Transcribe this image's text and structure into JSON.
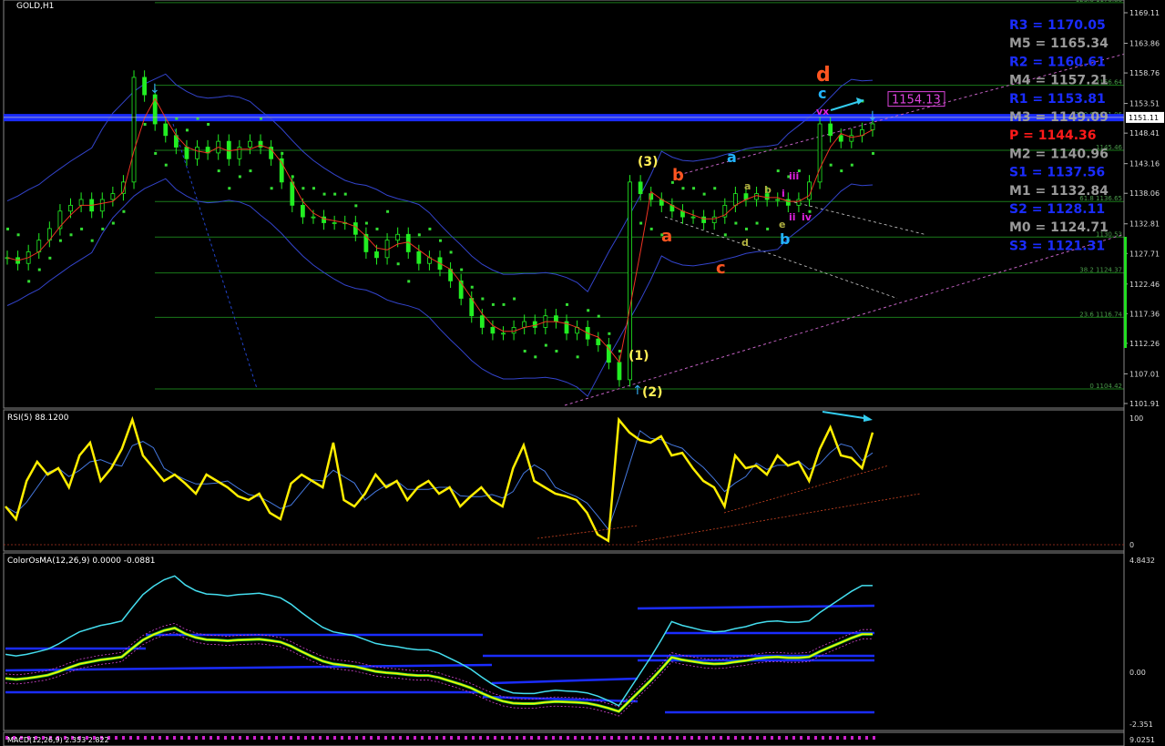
{
  "chart_data": {
    "type": "line",
    "title": "GOLD,H1",
    "price_axis": {
      "ticks": [
        "1169.11",
        "1163.86",
        "1158.76",
        "1153.51",
        "1148.41",
        "1143.16",
        "1138.06",
        "1132.81",
        "1127.71",
        "1122.46",
        "1117.36",
        "1112.26",
        "1107.01",
        "1101.91"
      ],
      "ylim": [
        1100.5,
        1171.0
      ],
      "current_price": "1151.11"
    },
    "pivots": [
      {
        "name": "R3",
        "value": "1170.05",
        "color": "#1a2cff"
      },
      {
        "name": "M5",
        "value": "1165.34",
        "color": "#9a9a9a"
      },
      {
        "name": "R2",
        "value": "1160.61",
        "color": "#1a2cff"
      },
      {
        "name": "M4",
        "value": "1157.21",
        "color": "#9a9a9a"
      },
      {
        "name": "R1",
        "value": "1153.81",
        "color": "#1a2cff"
      },
      {
        "name": "M3",
        "value": "1149.09",
        "color": "#9a9a9a"
      },
      {
        "name": "P",
        "value": "1144.36",
        "color": "#ff1a1a"
      },
      {
        "name": "M2",
        "value": "1140.96",
        "color": "#9a9a9a"
      },
      {
        "name": "S1",
        "value": "1137.56",
        "color": "#1a2cff"
      },
      {
        "name": "M1",
        "value": "1132.84",
        "color": "#9a9a9a"
      },
      {
        "name": "S2",
        "value": "1128.11",
        "color": "#1a2cff"
      },
      {
        "name": "M0",
        "value": "1124.71",
        "color": "#9a9a9a"
      },
      {
        "name": "S3",
        "value": "1121.31",
        "color": "#1a2cff"
      }
    ],
    "fib_levels": [
      {
        "label": "123.6 1170.86",
        "price": 1170.86
      },
      {
        "label": "1156.64",
        "price": 1156.64
      },
      {
        "label": "150.6 1151.06",
        "price": 1151.06
      },
      {
        "label": "1145.46",
        "price": 1145.46
      },
      {
        "label": "61.8 1136.65",
        "price": 1136.65
      },
      {
        "label": "1130.53",
        "price": 1130.53
      },
      {
        "label": "38.2 1124.37",
        "price": 1124.37
      },
      {
        "label": "23.6 1116.74",
        "price": 1116.74
      },
      {
        "label": "0 1104.42",
        "price": 1104.42
      }
    ],
    "price_box": "1154.13",
    "price_series": [
      1127,
      1126,
      1128,
      1130,
      1132,
      1135,
      1136,
      1137,
      1135,
      1137,
      1138,
      1140,
      1158,
      1155,
      1150,
      1148,
      1146,
      1144,
      1146,
      1145,
      1147,
      1144,
      1146,
      1147,
      1146,
      1144,
      1140,
      1136,
      1134,
      1134,
      1133,
      1133,
      1133,
      1131,
      1128,
      1127,
      1130,
      1131,
      1128,
      1126,
      1127,
      1125,
      1123,
      1120,
      1117,
      1115,
      1114,
      1114,
      1115,
      1116,
      1115,
      1117,
      1116,
      1114,
      1115,
      1113,
      1112,
      1109,
      1106,
      1140,
      1138,
      1137,
      1136,
      1135,
      1134,
      1134,
      1133,
      1134,
      1136,
      1138,
      1137,
      1138,
      1137,
      1137,
      1136,
      1137,
      1140,
      1150,
      1148,
      1147,
      1148,
      1149,
      1150
    ],
    "wave_labels": [
      {
        "text": "(1)",
        "color": "#ffee55"
      },
      {
        "text": "(2)",
        "color": "#ffee55"
      },
      {
        "text": "(3)",
        "color": "#ffee55"
      },
      {
        "text": "a",
        "color": "#ff5520"
      },
      {
        "text": "b",
        "color": "#ff5520"
      },
      {
        "text": "c",
        "color": "#ff5520"
      },
      {
        "text": "d",
        "color": "#ff5520"
      },
      {
        "text": "a",
        "color": "#22b4ff"
      },
      {
        "text": "b",
        "color": "#22b4ff"
      },
      {
        "text": "c",
        "color": "#22b4ff"
      },
      {
        "text": "a",
        "color": "#b0b040"
      },
      {
        "text": "b",
        "color": "#b0b040"
      },
      {
        "text": "d",
        "color": "#b0b040"
      },
      {
        "text": "e",
        "color": "#b0b040"
      },
      {
        "text": "i",
        "color": "#dd22dd"
      },
      {
        "text": "ii",
        "color": "#dd22dd"
      },
      {
        "text": "iii",
        "color": "#dd22dd"
      },
      {
        "text": "iv",
        "color": "#dd22dd"
      },
      {
        "text": "vx",
        "color": "#dd22dd"
      }
    ],
    "rsi": {
      "title": "RSI(5) 88.1200",
      "ticks": [
        "100",
        "0"
      ],
      "values": [
        30,
        20,
        50,
        65,
        55,
        60,
        45,
        70,
        80,
        50,
        60,
        75,
        98,
        70,
        60,
        50,
        55,
        48,
        40,
        55,
        50,
        45,
        38,
        35,
        40,
        25,
        20,
        48,
        55,
        50,
        45,
        80,
        35,
        30,
        40,
        55,
        45,
        50,
        35,
        45,
        50,
        40,
        45,
        30,
        38,
        45,
        35,
        30,
        60,
        78,
        50,
        45,
        40,
        38,
        35,
        25,
        8,
        3,
        98,
        88,
        82,
        80,
        85,
        70,
        72,
        60,
        50,
        45,
        30,
        70,
        60,
        62,
        55,
        70,
        62,
        65,
        50,
        75,
        92,
        70,
        68,
        60,
        88
      ]
    },
    "osma": {
      "title": "ColorOsMA(12,26,9) 0.0000 -0.0881",
      "ticks": [
        "4.8432",
        "0.00",
        "-2.351"
      ]
    },
    "macd": {
      "title": "MACD(12,26,9) 2.353 2.822",
      "ticks": [
        "9.0251"
      ]
    }
  }
}
